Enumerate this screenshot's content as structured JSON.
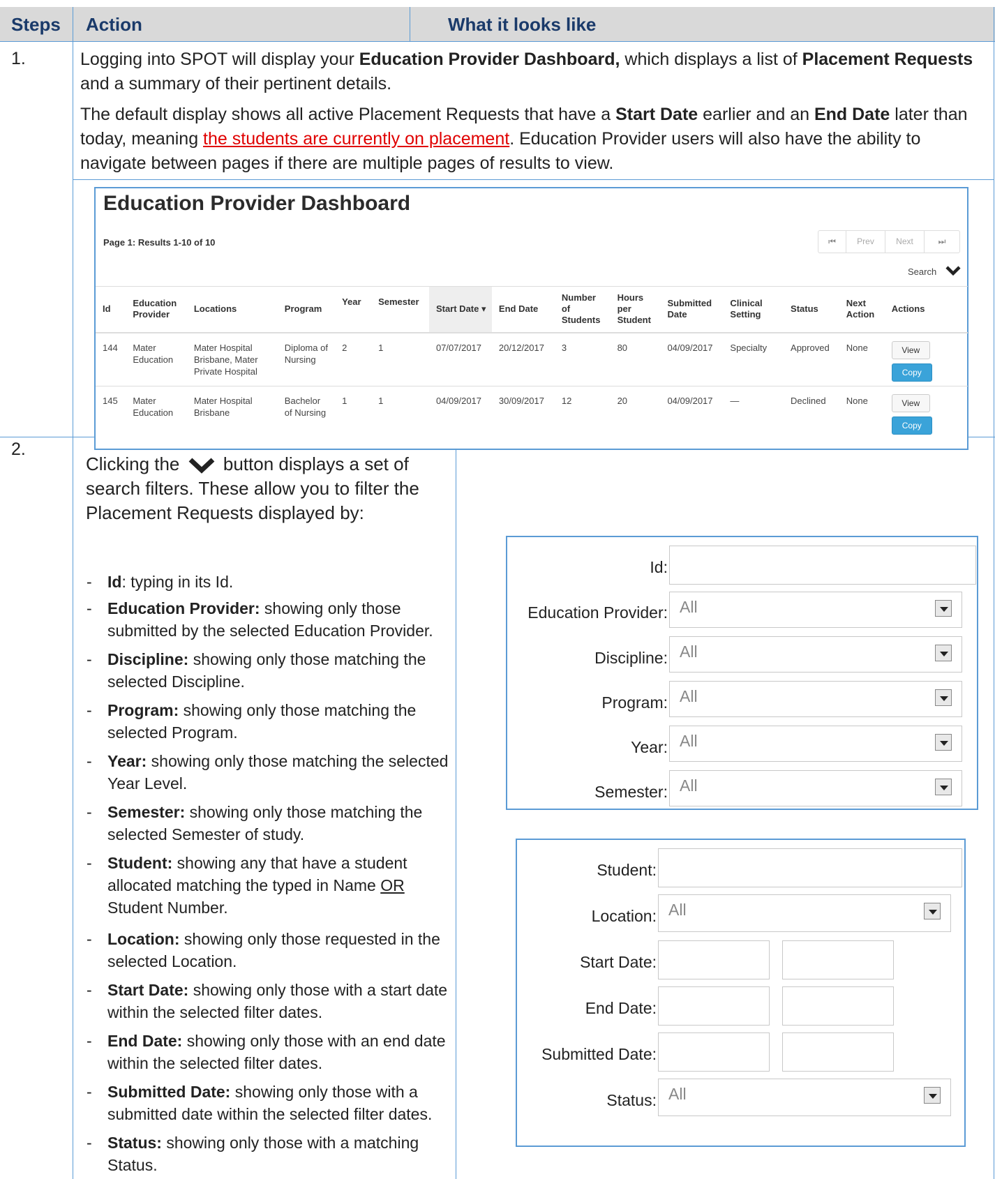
{
  "header": {
    "steps": "Steps",
    "action": "Action",
    "looks_like": "What it looks like"
  },
  "step1": {
    "number": "1.",
    "para1_a": "Logging into SPOT will display your ",
    "para1_b": "Education Provider Dashboard,",
    "para1_c": " which displays a list of ",
    "para1_d": "Placement Requests",
    "para1_e": " and a summary of their pertinent details.",
    "para2_a": "The default display shows all active Placement Requests that have a ",
    "para2_b": "Start Date",
    "para2_c": " earlier and an ",
    "para2_d": "End Date",
    "para2_e": " later than today, meaning ",
    "para2_f": "the students are currently on placement",
    "para2_g": ". Education Provider users will also have the ability to navigate between pages if there are multiple pages of results to view."
  },
  "dashboard": {
    "title": "Education Provider Dashboard",
    "page_info": "Page 1: Results 1-10 of 10",
    "pager": [
      "⏮",
      "Prev",
      "Next",
      "⏭"
    ],
    "search_label": "Search",
    "columns": [
      "Id",
      "Education Provider",
      "Locations",
      "Program",
      "Year",
      "Semester",
      "Start Date ▾",
      "End Date",
      "Number of Students",
      "Hours per Student",
      "Submitted Date",
      "Clinical Setting",
      "Status",
      "Next Action",
      "Actions"
    ],
    "rows": [
      [
        "144",
        "Mater Education",
        "Mater Hospital Brisbane, Mater Private Hospital",
        "Diploma of Nursing",
        "2",
        "1",
        "07/07/2017",
        "20/12/2017",
        "3",
        "80",
        "04/09/2017",
        "Specialty",
        "Approved",
        "None"
      ],
      [
        "145",
        "Mater Education",
        "Mater Hospital Brisbane",
        "Bachelor of Nursing",
        "1",
        "1",
        "04/09/2017",
        "30/09/2017",
        "12",
        "20",
        "04/09/2017",
        "—",
        "Declined",
        "None"
      ]
    ],
    "view_label": "View",
    "copy_label": "Copy"
  },
  "step2": {
    "number": "2.",
    "intro_a": "Clicking the",
    "intro_b": "button displays a set of search filters. These allow you to filter the Placement Requests displayed by:",
    "items": [
      {
        "term": "Id",
        "text": ": typing in its Id."
      },
      {
        "term": "Education Provider:",
        "text": " showing only those submitted by the selected Education Provider."
      },
      {
        "term": "Discipline:",
        "text": " showing only those matching the selected Discipline."
      },
      {
        "term": "Program:",
        "text": " showing only those matching the selected Program."
      },
      {
        "term": "Year:",
        "text": " showing only those matching the selected Year Level."
      },
      {
        "term": "Semester:",
        "text": " showing only those matching the selected Semester of study."
      },
      {
        "term": "Student:",
        "text": " showing any that have a student allocated matching the typed in Name ",
        "extra_u": "OR",
        "extra": " Student Number."
      },
      {
        "term": "Location:",
        "text": " showing only those requested in the selected Location."
      },
      {
        "term": "Start Date:",
        "text": " showing only those with a start date within the selected filter dates."
      },
      {
        "term": "End Date:",
        "text": " showing only those with an end date within the selected filter dates."
      },
      {
        "term": "Submitted Date:",
        "text": " showing only those with a submitted date within the selected filter dates."
      },
      {
        "term": "Status:",
        "text": " showing only those with a matching Status."
      }
    ]
  },
  "filters1": {
    "id": "Id:",
    "education_provider": "Education Provider:",
    "discipline": "Discipline:",
    "program": "Program:",
    "year": "Year:",
    "semester": "Semester:",
    "all": "All"
  },
  "filters2": {
    "student": "Student:",
    "location": "Location:",
    "start_date": "Start Date:",
    "end_date": "End Date:",
    "submitted_date": "Submitted Date:",
    "status": "Status:",
    "all": "All"
  },
  "colors": {
    "border": "#5b9bd5",
    "header_bg": "#d9d9d9",
    "header_text": "#1a3a6a",
    "link_red": "#e00000",
    "copy_button": "#3aa3d9"
  }
}
